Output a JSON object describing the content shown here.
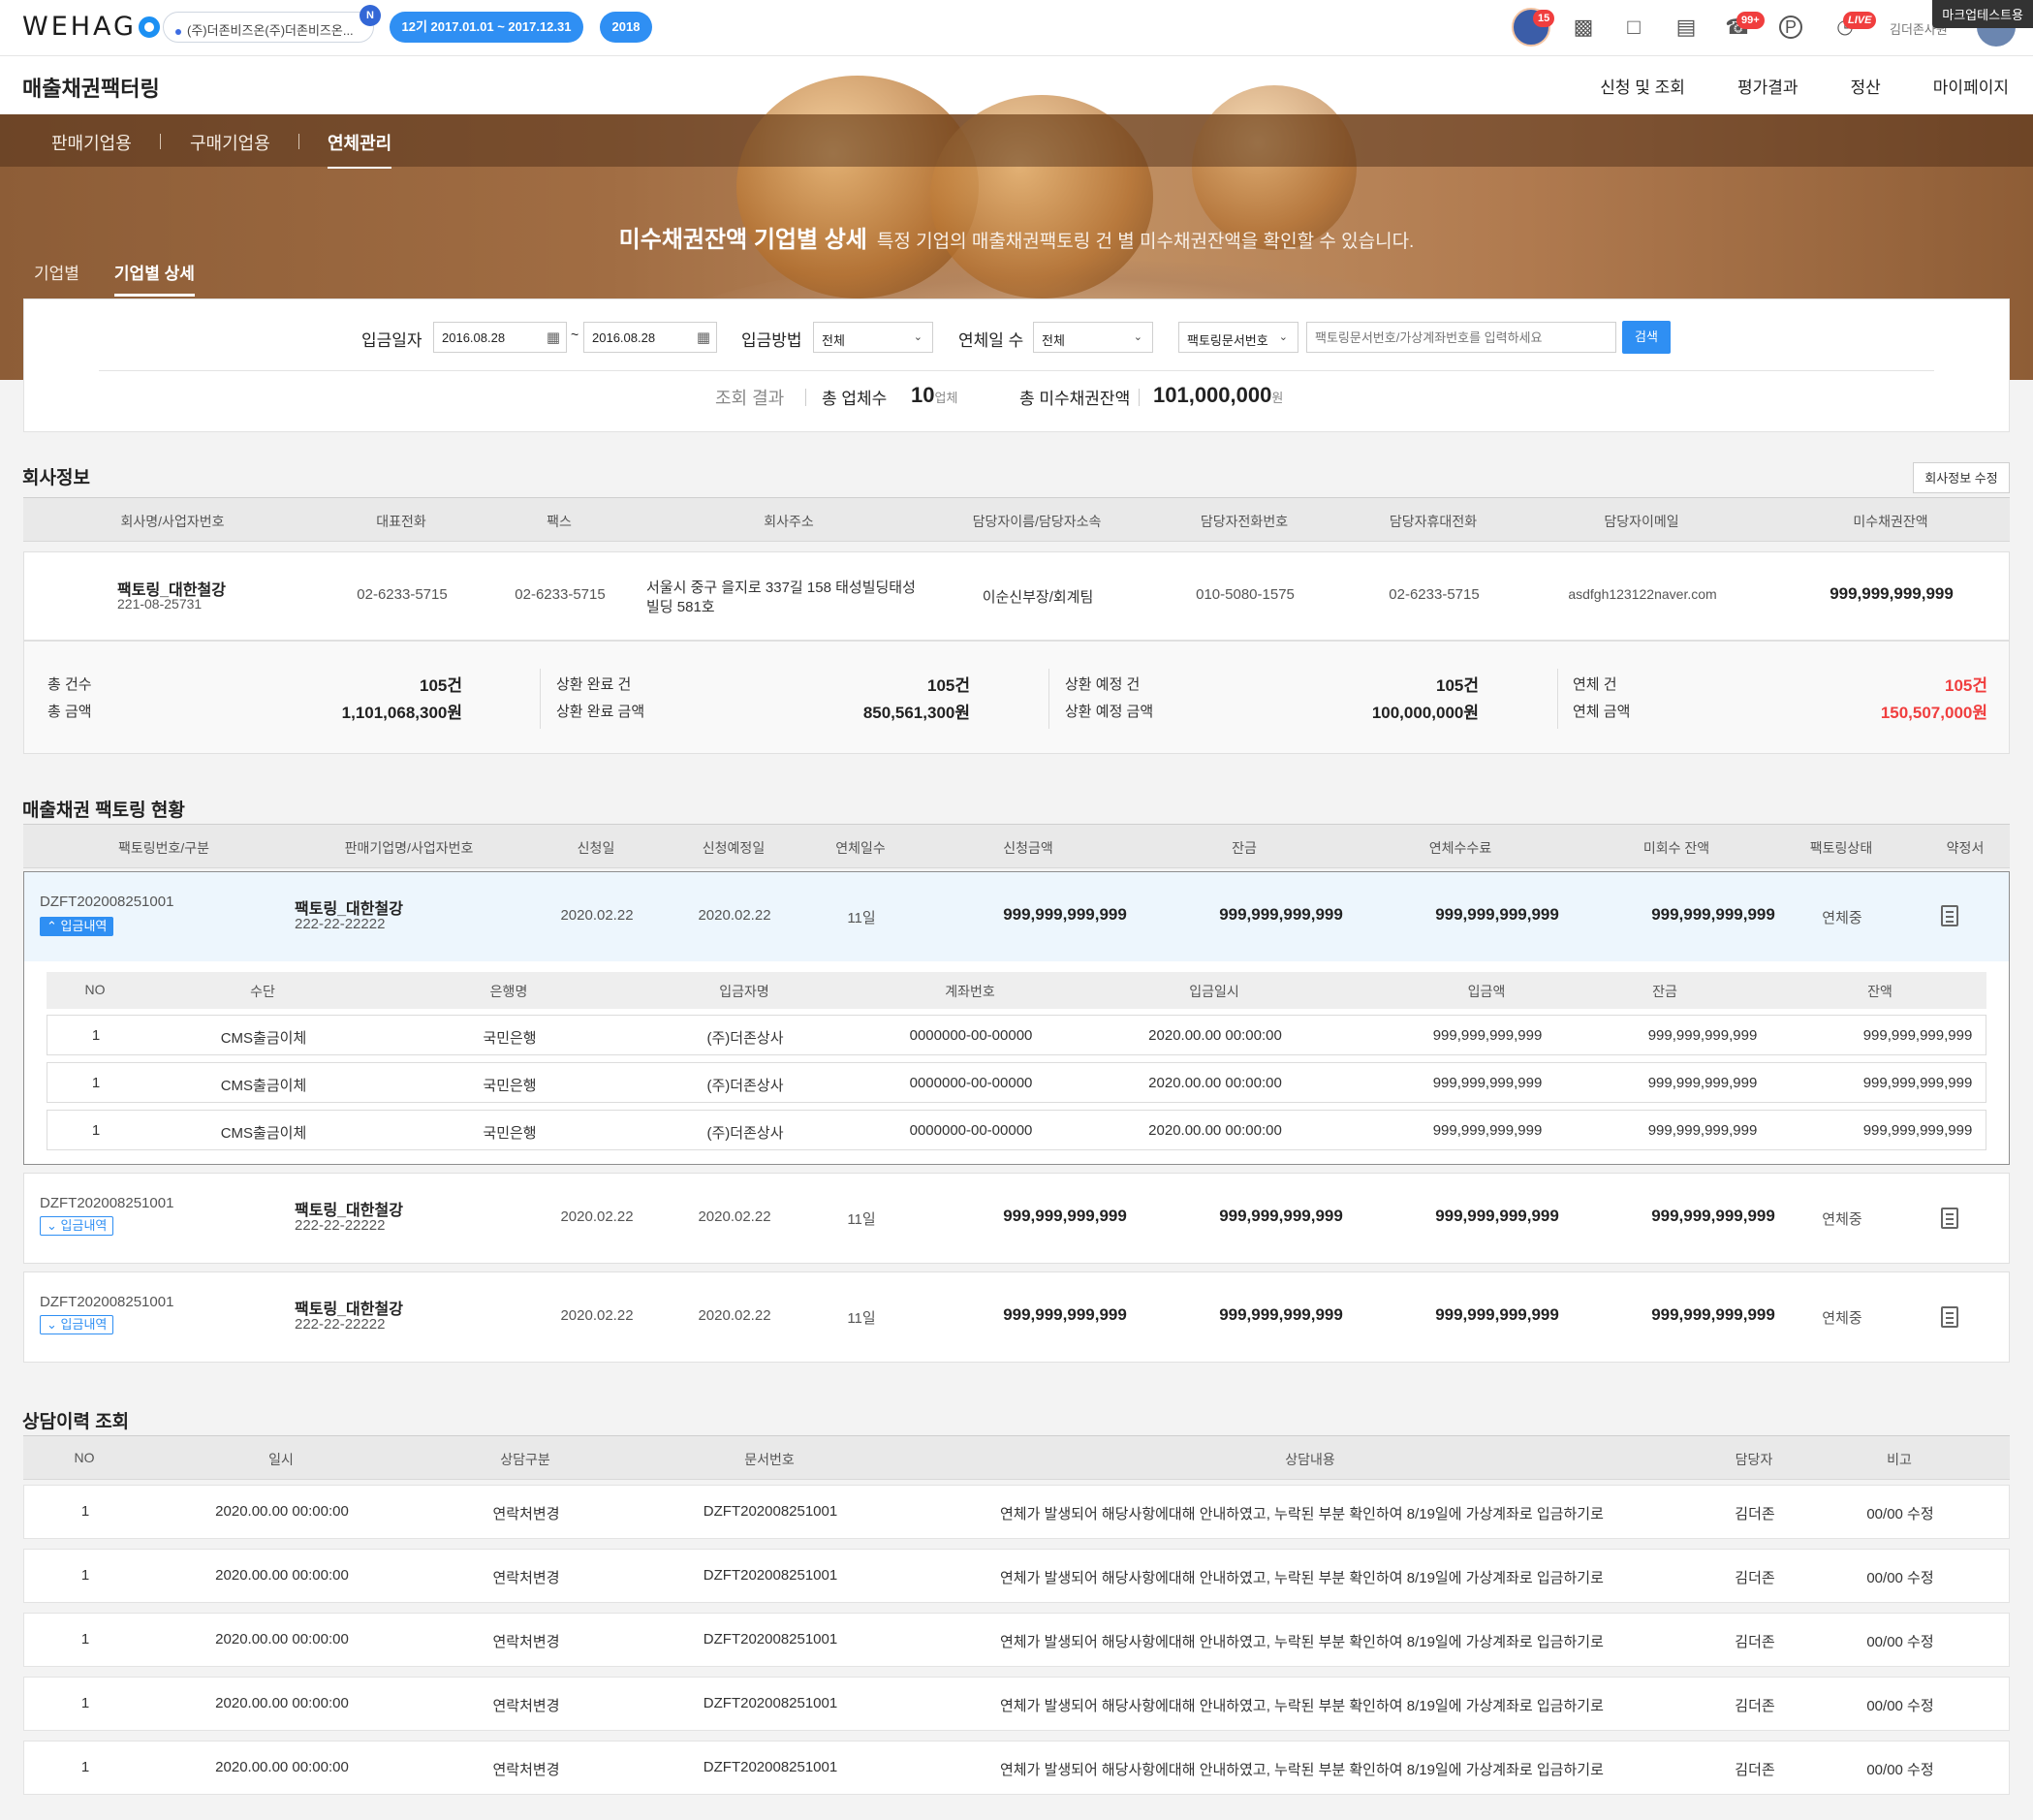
{
  "header": {
    "logo": "WEHAG",
    "company": "(주)더존비즈온(주)더존비즈온...",
    "company_badge": "N",
    "period": "12기 2017.01.01 ~ 2017.12.31",
    "year": "2018",
    "avatar_badge": "15",
    "notif_badge": "99+",
    "live_badge": "LIVE",
    "user_name": "김더존사원",
    "mark_label": "마크업테스트용",
    "icons": [
      "avatar-icon",
      "video-icon",
      "message-icon",
      "note-icon",
      "bell-icon",
      "p-icon",
      "live-icon"
    ]
  },
  "service": {
    "title": "매출채권팩터링",
    "menu": [
      "신청 및 조회",
      "평가결과",
      "정산",
      "마이페이지"
    ]
  },
  "tabs": [
    "판매기업용",
    "구매기업용",
    "연체관리"
  ],
  "hero": {
    "title": "미수채권잔액 기업별 상세",
    "desc": "특정 기업의 매출채권팩토링 건 별 미수채권잔액을 확인할 수 있습니다."
  },
  "subtabs": [
    "기업별",
    "기업별 상세"
  ],
  "search": {
    "date_label": "입금일자",
    "date_from": "2016.08.28",
    "date_to": "2016.08.28",
    "tilde": "~",
    "method_label": "입금방법",
    "method_value": "전체",
    "overdue_label": "연체일 수",
    "overdue_value": "전체",
    "doc_type": "팩토링문서번호",
    "keyword_placeholder": "팩토링문서번호/가상계좌번호를 입력하세요",
    "button": "검색"
  },
  "result": {
    "label": "조회 결과",
    "count_label": "총 업체수",
    "count": "10",
    "count_unit": "업체",
    "amount_label": "총 미수채권잔액",
    "amount": "101,000,000",
    "amount_unit": "원"
  },
  "company": {
    "section_title": "회사정보",
    "edit_button": "회사정보 수정",
    "headers": [
      "회사명/사업자번호",
      "대표전화",
      "팩스",
      "회사주소",
      "담당자이름/담당자소속",
      "담당자전화번호",
      "담당자휴대전화",
      "담당자이메일",
      "미수채권잔액"
    ],
    "name": "팩토링_대한철강",
    "biz_no": "221-08-25731",
    "phone": "02-6233-5715",
    "fax": "02-6233-5715",
    "address1": "서울시 중구 을지로 337길 158 태성빌딩태성",
    "address2": "빌딩 581호",
    "manager": "이순신부장/회계팀",
    "manager_phone": "010-5080-1575",
    "manager_mobile": "02-6233-5715",
    "email": "asdfgh123122naver.com",
    "receivable": "999,999,999,999"
  },
  "summary": [
    {
      "label1": "총 건수",
      "value1": "105건",
      "label2": "총 금액",
      "value2": "1,101,068,300원"
    },
    {
      "label1": "상환 완료 건",
      "value1": "105건",
      "label2": "상환 완료 금액",
      "value2": "850,561,300원"
    },
    {
      "label1": "상환 예정 건",
      "value1": "105건",
      "label2": "상환 예정 금액",
      "value2": "100,000,000원"
    },
    {
      "label1": "연체 건",
      "value1": "105건",
      "label2": "연체 금액",
      "value2": "150,507,000원"
    }
  ],
  "factoring": {
    "section_title": "매출채권 팩토링 현황",
    "headers": [
      "팩토링번호/구분",
      "판매기업명/사업자번호",
      "신청일",
      "신청예정일",
      "연체일수",
      "신청금액",
      "잔금",
      "연체수수료",
      "미회수 잔액",
      "팩토링상태",
      "약정서"
    ],
    "rows": [
      {
        "doc": "DZFT202008251001",
        "tag": "입금내역",
        "name": "팩토링_대한철강",
        "biz": "222-22-22222",
        "apply": "2020.02.22",
        "plan": "2020.02.22",
        "days": "11일",
        "amt": "999,999,999,999",
        "balance": "999,999,999,999",
        "fee": "999,999,999,999",
        "unpaid": "999,999,999,999",
        "status": "연체중"
      },
      {
        "doc": "DZFT202008251001",
        "tag": "입금내역",
        "name": "팩토링_대한철강",
        "biz": "222-22-22222",
        "apply": "2020.02.22",
        "plan": "2020.02.22",
        "days": "11일",
        "amt": "999,999,999,999",
        "balance": "999,999,999,999",
        "fee": "999,999,999,999",
        "unpaid": "999,999,999,999",
        "status": "연체중"
      },
      {
        "doc": "DZFT202008251001",
        "tag": "입금내역",
        "name": "팩토링_대한철강",
        "biz": "222-22-22222",
        "apply": "2020.02.22",
        "plan": "2020.02.22",
        "days": "11일",
        "amt": "999,999,999,999",
        "balance": "999,999,999,999",
        "fee": "999,999,999,999",
        "unpaid": "999,999,999,999",
        "status": "연체중"
      }
    ],
    "deposit_headers": [
      "NO",
      "수단",
      "은행명",
      "입금자명",
      "계좌번호",
      "입금일시",
      "입금액",
      "잔금",
      "잔액"
    ],
    "deposits": [
      {
        "no": "1",
        "method": "CMS출금이체",
        "bank": "국민은행",
        "depositor": "(주)더존상사",
        "account": "0000000-00-00000",
        "datetime": "2020.00.00 00:00:00",
        "amount": "999,999,999,999",
        "balance": "999,999,999,999",
        "remain": "999,999,999,999"
      },
      {
        "no": "1",
        "method": "CMS출금이체",
        "bank": "국민은행",
        "depositor": "(주)더존상사",
        "account": "0000000-00-00000",
        "datetime": "2020.00.00 00:00:00",
        "amount": "999,999,999,999",
        "balance": "999,999,999,999",
        "remain": "999,999,999,999"
      },
      {
        "no": "1",
        "method": "CMS출금이체",
        "bank": "국민은행",
        "depositor": "(주)더존상사",
        "account": "0000000-00-00000",
        "datetime": "2020.00.00 00:00:00",
        "amount": "999,999,999,999",
        "balance": "999,999,999,999",
        "remain": "999,999,999,999"
      }
    ]
  },
  "history": {
    "section_title": "상담이력 조회",
    "headers": [
      "NO",
      "일시",
      "상담구분",
      "문서번호",
      "상담내용",
      "담당자",
      "비고"
    ],
    "rows": [
      {
        "no": "1",
        "datetime": "2020.00.00 00:00:00",
        "type": "연락처변경",
        "doc": "DZFT202008251001",
        "content": "연체가 발생되어 해당사항에대해 안내하였고, 누락된 부분 확인하여 8/19일에 가상계좌로 입금하기로",
        "manager": "김더존",
        "note": "00/00 수정"
      },
      {
        "no": "1",
        "datetime": "2020.00.00 00:00:00",
        "type": "연락처변경",
        "doc": "DZFT202008251001",
        "content": "연체가 발생되어 해당사항에대해 안내하였고, 누락된 부분 확인하여 8/19일에 가상계좌로 입금하기로",
        "manager": "김더존",
        "note": "00/00 수정"
      },
      {
        "no": "1",
        "datetime": "2020.00.00 00:00:00",
        "type": "연락처변경",
        "doc": "DZFT202008251001",
        "content": "연체가 발생되어 해당사항에대해 안내하였고, 누락된 부분 확인하여 8/19일에 가상계좌로 입금하기로",
        "manager": "김더존",
        "note": "00/00 수정"
      },
      {
        "no": "1",
        "datetime": "2020.00.00 00:00:00",
        "type": "연락처변경",
        "doc": "DZFT202008251001",
        "content": "연체가 발생되어 해당사항에대해 안내하였고, 누락된 부분 확인하여 8/19일에 가상계좌로 입금하기로",
        "manager": "김더존",
        "note": "00/00 수정"
      },
      {
        "no": "1",
        "datetime": "2020.00.00 00:00:00",
        "type": "연락처변경",
        "doc": "DZFT202008251001",
        "content": "연체가 발생되어 해당사항에대해 안내하였고, 누락된 부분 확인하여 8/19일에 가상계좌로 입금하기로",
        "manager": "김더존",
        "note": "00/00 수정"
      }
    ]
  },
  "colors": {
    "primary": "#2f8ff3",
    "overdue": "#f03e3e"
  }
}
